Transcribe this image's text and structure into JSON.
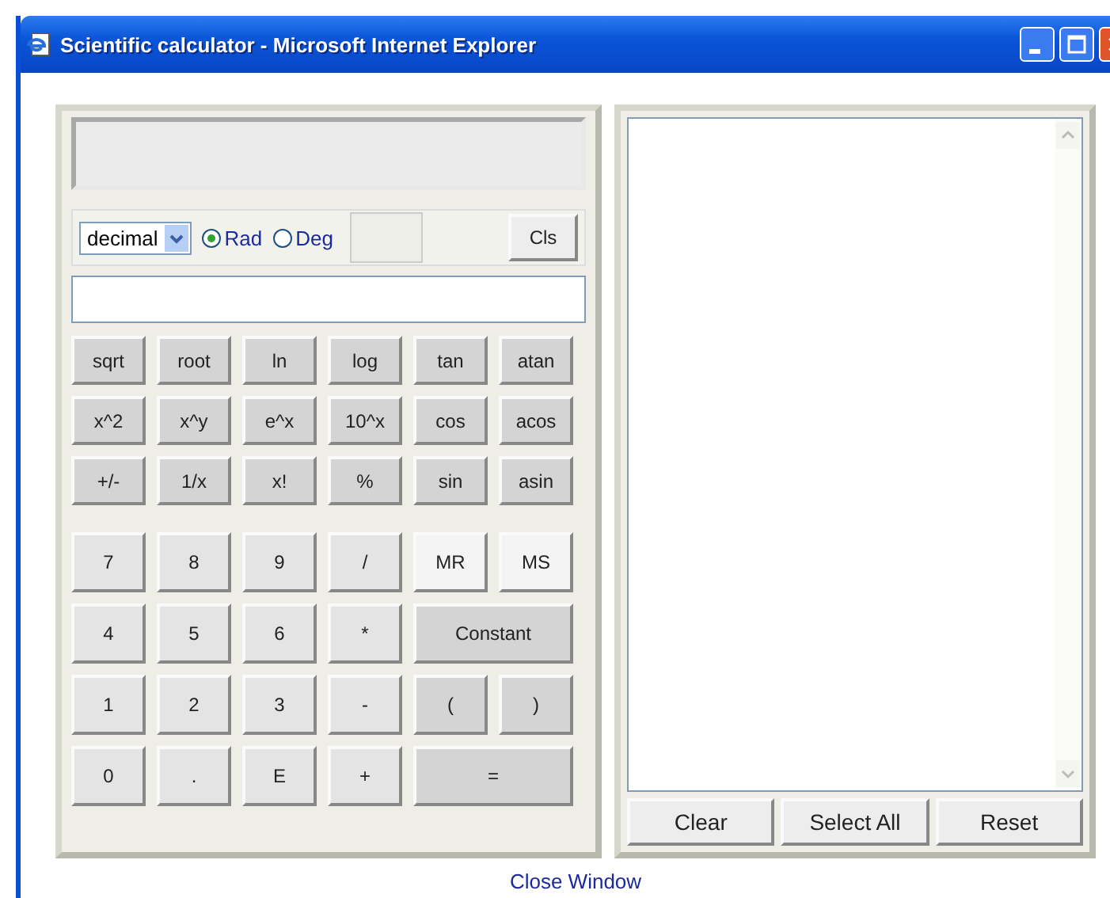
{
  "window": {
    "title": "Scientific calculator - Microsoft Internet Explorer"
  },
  "calculator": {
    "base_select": {
      "value": "decimal"
    },
    "angle_modes": [
      {
        "label": "Rad",
        "selected": true
      },
      {
        "label": "Deg",
        "selected": false
      }
    ],
    "clear_button": "Cls",
    "key_rows": [
      [
        {
          "label": "sqrt",
          "kind": "function",
          "wide": false
        },
        {
          "label": "root",
          "kind": "function",
          "wide": false
        },
        {
          "label": "ln",
          "kind": "function",
          "wide": false
        },
        {
          "label": "log",
          "kind": "function",
          "wide": false
        },
        {
          "label": "tan",
          "kind": "function",
          "wide": false
        },
        {
          "label": "atan",
          "kind": "function",
          "wide": false
        }
      ],
      [
        {
          "label": "x^2",
          "kind": "function",
          "wide": false
        },
        {
          "label": "x^y",
          "kind": "function",
          "wide": false
        },
        {
          "label": "e^x",
          "kind": "function",
          "wide": false
        },
        {
          "label": "10^x",
          "kind": "function",
          "wide": false
        },
        {
          "label": "cos",
          "kind": "function",
          "wide": false
        },
        {
          "label": "acos",
          "kind": "function",
          "wide": false
        }
      ],
      [
        {
          "label": "+/-",
          "kind": "function",
          "wide": false
        },
        {
          "label": "1/x",
          "kind": "function",
          "wide": false
        },
        {
          "label": "x!",
          "kind": "function",
          "wide": false
        },
        {
          "label": "%",
          "kind": "function",
          "wide": false
        },
        {
          "label": "sin",
          "kind": "function",
          "wide": false
        },
        {
          "label": "asin",
          "kind": "function",
          "wide": false
        }
      ],
      [
        {
          "label": "7",
          "kind": "digit",
          "wide": false
        },
        {
          "label": "8",
          "kind": "digit",
          "wide": false
        },
        {
          "label": "9",
          "kind": "digit",
          "wide": false
        },
        {
          "label": "/",
          "kind": "digit",
          "wide": false
        },
        {
          "label": "MR",
          "kind": "memory",
          "wide": false
        },
        {
          "label": "MS",
          "kind": "memory",
          "wide": false
        }
      ],
      [
        {
          "label": "4",
          "kind": "digit",
          "wide": false
        },
        {
          "label": "5",
          "kind": "digit",
          "wide": false
        },
        {
          "label": "6",
          "kind": "digit",
          "wide": false
        },
        {
          "label": "*",
          "kind": "digit",
          "wide": false
        },
        {
          "label": "Constant",
          "kind": "function",
          "wide": true
        }
      ],
      [
        {
          "label": "1",
          "kind": "digit",
          "wide": false
        },
        {
          "label": "2",
          "kind": "digit",
          "wide": false
        },
        {
          "label": "3",
          "kind": "digit",
          "wide": false
        },
        {
          "label": "-",
          "kind": "digit",
          "wide": false
        },
        {
          "label": "(",
          "kind": "function",
          "wide": false
        },
        {
          "label": ")",
          "kind": "function",
          "wide": false
        }
      ],
      [
        {
          "label": "0",
          "kind": "digit",
          "wide": false
        },
        {
          "label": ".",
          "kind": "digit",
          "wide": false
        },
        {
          "label": "E",
          "kind": "digit",
          "wide": false
        },
        {
          "label": "+",
          "kind": "digit",
          "wide": false
        },
        {
          "label": "=",
          "kind": "function",
          "wide": true
        }
      ]
    ]
  },
  "history": {
    "buttons": [
      "Clear",
      "Select All",
      "Reset"
    ]
  },
  "close_link": "Close Window"
}
